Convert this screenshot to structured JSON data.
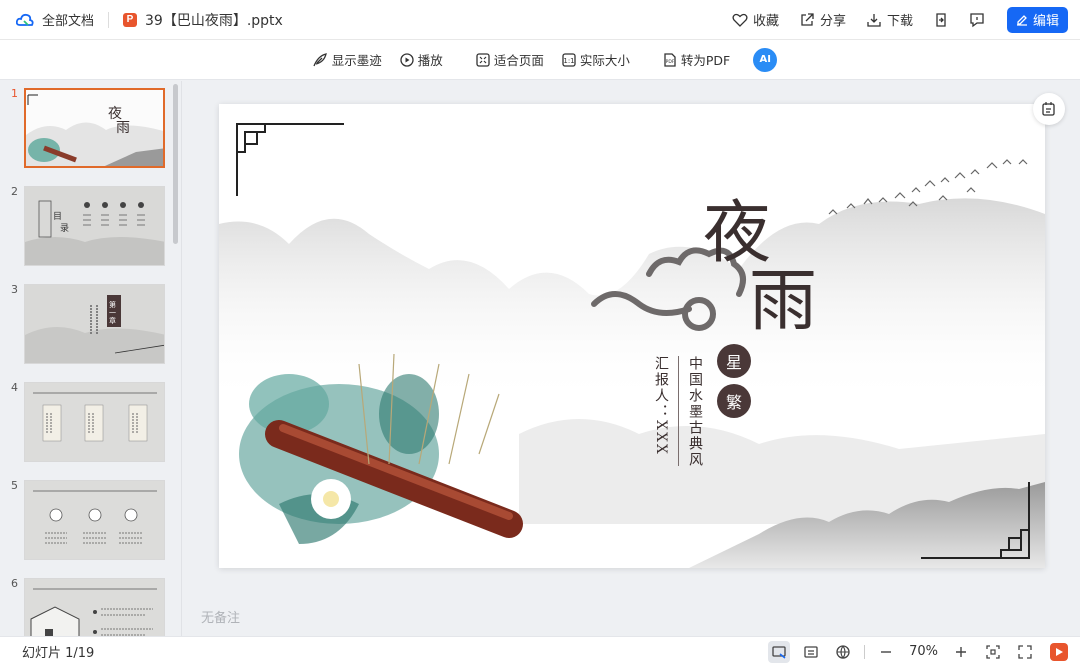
{
  "topbar": {
    "breadcrumb": "全部文档",
    "file_badge": "P",
    "filename": "39【巴山夜雨】.pptx",
    "actions": {
      "favorite": "收藏",
      "share": "分享",
      "download": "下载",
      "edit": "编辑"
    }
  },
  "toolbar": {
    "show_ink": "显示墨迹",
    "play": "播放",
    "fit_page": "适合页面",
    "actual_size": "实际大小",
    "to_pdf": "转为PDF",
    "ai_label": "AI"
  },
  "sidebar": {
    "thumbnails": [
      {
        "number": "1",
        "active": true
      },
      {
        "number": "2",
        "active": false
      },
      {
        "number": "3",
        "active": false
      },
      {
        "number": "4",
        "active": false
      },
      {
        "number": "5",
        "active": false
      },
      {
        "number": "6",
        "active": false
      }
    ]
  },
  "slide": {
    "title_char_1": "夜",
    "title_char_2": "雨",
    "seal_1": "星",
    "seal_2": "繁",
    "subtitle": "中国水墨古典风",
    "reporter": "汇报人：XXX",
    "thumb1_char1": "夜",
    "thumb1_char2": "雨",
    "thumb2_title": "目录",
    "thumb3_title": "第一章"
  },
  "notes_placeholder": "无备注",
  "statusbar": {
    "slide_counter": "幻灯片 1/19",
    "zoom": "70%"
  },
  "colors": {
    "primary": "#1668f5",
    "ppt_badge": "#e8552d",
    "active_thumb_border": "#e06a2a",
    "ink": "#3a2f2f"
  }
}
